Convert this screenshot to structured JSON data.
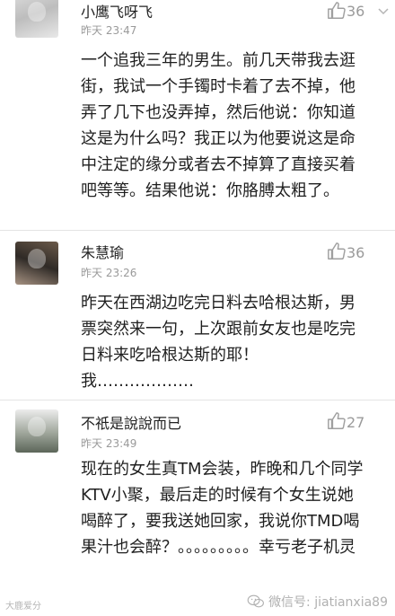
{
  "comments": [
    {
      "username": "小鹰飞呀飞",
      "time": "昨天 23:47",
      "likes": "36",
      "text": "一个追我三年的男生。前几天带我去逛街，我试一个手镯时卡着了去不掉，他弄了几下也没弄掉，然后他说：你知道这是为什么吗？我正以为他要说这是命中注定的缘分或者去不掉算了直接买着吧等等。结果他说：你胳膊太粗了。"
    },
    {
      "username": "朱慧瑜",
      "time": "昨天 23:26",
      "likes": "36",
      "text": "昨天在西湖边吃完日料去哈根达斯，男票突然来一句，上次跟前女友也是吃完日料来吃哈根达斯的耶！我………………"
    },
    {
      "username": "不祇是說說而已",
      "time": "昨天 23:49",
      "likes": "27",
      "text": "现在的女生真TM会装，昨晚和几个同学KTV小聚，最后走的时候有个女生说她喝醉了，要我送她回家，我说你TMD喝果汁也会醉？。。。。。。。。。幸亏老子机灵"
    }
  ],
  "watermark": {
    "left_text": "大鹿爱分",
    "right_text": "微信号: jiatianxia89"
  }
}
